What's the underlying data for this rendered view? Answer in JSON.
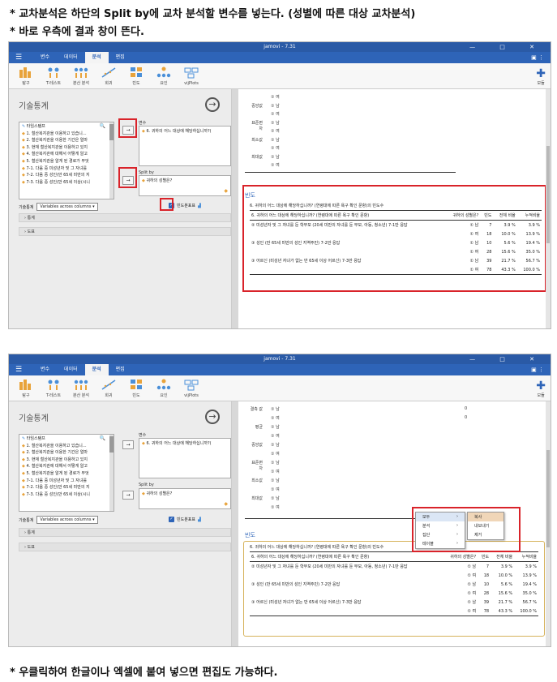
{
  "notes": {
    "line1": "* 교차분석은 하단의 Split by에 교차 분석할 변수를 넣는다. (성별에 따른 대상 교차분석)",
    "line2": "* 바로 우측에 결과 창이 뜬다.",
    "line3": "* 우클릭하여 한글이나 엑셀에 붙여 넣으면 편집도 가능하다."
  },
  "app": {
    "title": "jamovi - 7.31",
    "window_buttons": "— □ ✕",
    "menu_tabs": [
      "변수",
      "데이터",
      "분석",
      "편집"
    ],
    "active_tab": "분석",
    "ribbon": [
      "탐구",
      "T-테스트",
      "분산 분석",
      "회귀",
      "빈도",
      "요인",
      "vijPlots"
    ],
    "modules_label": "모듈"
  },
  "analysis": {
    "title": "기술통계",
    "source_vars": [
      "타임스탬프",
      "1. 철산복지관을 이용하고 있습니...",
      "2. 철산복지관을 이용한 기간은 얼마",
      "3. 현재 철산복지관을 이용하고 있지",
      "4. 철산복지관에 대해서 어떻게 알고",
      "5. 철산복지관을 알게 된 경로가 무엇",
      "7-1. 다음 중 미성년자 및 그 자녀를 ",
      "7-2. 다음 중 성인(만 65세 미만의 지",
      "7-3. 다음 중 성인(만 65세 이상(시니"
    ],
    "variables_label": "변수",
    "variables_value": "6. 귀하의 어느 대상에 해당하십니까?(",
    "splitby_label": "Split by",
    "splitby_value": "귀하의 성별은?",
    "move_button": "→",
    "datatable_label": "기술통계",
    "datatable_select": "Variables across columns",
    "freq_checkbox": "빈도분표표",
    "stats_section": "통계",
    "plots_section": "도표"
  },
  "summary_rows": [
    {
      "stat": "",
      "group": "① 여"
    },
    {
      "stat": "중앙값",
      "group": "① 남"
    },
    {
      "stat": "",
      "group": "① 여"
    },
    {
      "stat": "표준편차",
      "group": "① 남"
    },
    {
      "stat": "",
      "group": "① 여"
    },
    {
      "stat": "최소값",
      "group": "① 남"
    },
    {
      "stat": "",
      "group": "① 여"
    },
    {
      "stat": "최대값",
      "group": "① 남"
    },
    {
      "stat": "",
      "group": "① 여"
    }
  ],
  "summary_rows2": [
    {
      "stat": "결측 값",
      "group": "① 남",
      "val": "0"
    },
    {
      "stat": "",
      "group": "① 여",
      "val": "0"
    },
    {
      "stat": "평균",
      "group": "① 남",
      "val": ""
    },
    {
      "stat": "",
      "group": "① 여",
      "val": ""
    },
    {
      "stat": "중앙값",
      "group": "① 남",
      "val": ""
    },
    {
      "stat": "",
      "group": "① 여",
      "val": ""
    },
    {
      "stat": "표준편차",
      "group": "① 남",
      "val": ""
    },
    {
      "stat": "",
      "group": "① 여",
      "val": ""
    },
    {
      "stat": "최소값",
      "group": "① 남",
      "val": ""
    },
    {
      "stat": "",
      "group": "① 여",
      "val": ""
    },
    {
      "stat": "최대값",
      "group": "① 남",
      "val": ""
    },
    {
      "stat": "",
      "group": "① 여",
      "val": ""
    }
  ],
  "freq": {
    "section_title": "빈도",
    "caption": "6. 귀하의 어느 대상에 해당하십니까? (연령대에 따른 욕구 확인 문항)의 빈도수",
    "headers": [
      "6. 귀하의 어느 대상에 해당하십니까? (연령대에 따른 욕구 확인 문항)",
      "귀하의 성별은?",
      "빈도",
      "전체 비율",
      "누적비율"
    ],
    "rows": [
      [
        "② 미성년자 및 그 자녀를 둔 학부모 (20세 미만의 자녀를 둔 부모, 아동, 청소년) 7-1만 응답",
        "① 남",
        "7",
        "3.9 %",
        "3.9 %"
      ],
      [
        "",
        "① 여",
        "18",
        "10.0 %",
        "13.9 %"
      ],
      [
        "③ 성인 (만 65세 미만의 성인 지역주민) 7-2만 응답",
        "① 남",
        "10",
        "5.6 %",
        "19.4 %"
      ],
      [
        "",
        "① 여",
        "28",
        "15.6 %",
        "35.0 %"
      ],
      [
        "③ 어르신 (미성년 자녀가 없는 만 65세 이상 어르신) 7-3만 응답",
        "① 남",
        "39",
        "21.7 %",
        "56.7 %"
      ],
      [
        "",
        "① 여",
        "78",
        "43.3 %",
        "100.0 %"
      ]
    ]
  },
  "context_menu": {
    "items": [
      "모두",
      "분석",
      "집단",
      "테이블"
    ],
    "submenu": [
      "복사",
      "내보내기",
      "제거"
    ]
  }
}
